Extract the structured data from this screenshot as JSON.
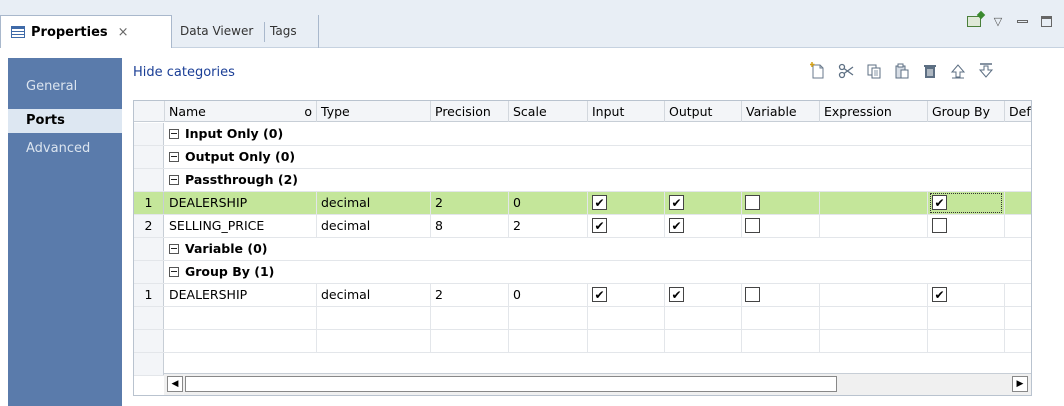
{
  "tabs": [
    {
      "label": "Properties",
      "active": true
    },
    {
      "label": "Data Viewer",
      "active": false
    },
    {
      "label": "Tags",
      "active": false
    }
  ],
  "tab_close": "×",
  "sidebar": {
    "items": [
      {
        "label": "General",
        "active": false
      },
      {
        "label": "Ports",
        "active": true
      },
      {
        "label": "Advanced",
        "active": false
      }
    ]
  },
  "hide_categories": "Hide categories",
  "toolbar_icons": [
    "new-port-icon",
    "cut-icon",
    "copy-icon",
    "paste-icon",
    "delete-icon",
    "move-up-icon",
    "move-down-icon"
  ],
  "grid": {
    "headers": [
      "Name",
      "Type",
      "Precision",
      "Scale",
      "Input",
      "Output",
      "Variable",
      "Expression",
      "Group By",
      "Defaul"
    ],
    "sort_marker": "o",
    "categories": {
      "input_only": "Input Only (0)",
      "output_only": "Output Only (0)",
      "passthrough": "Passthrough (2)",
      "variable": "Variable (0)",
      "group_by": "Group By (1)"
    },
    "passthrough_rows": [
      {
        "num": "1",
        "name": "DEALERSHIP",
        "type": "decimal",
        "precision": "2",
        "scale": "0",
        "input": true,
        "output": true,
        "variable": false,
        "group_by": true,
        "highlighted": true
      },
      {
        "num": "2",
        "name": "SELLING_PRICE",
        "type": "decimal",
        "precision": "8",
        "scale": "2",
        "input": true,
        "output": true,
        "variable": false,
        "group_by": false,
        "highlighted": false
      }
    ],
    "group_by_rows": [
      {
        "num": "1",
        "name": "DEALERSHIP",
        "type": "decimal",
        "precision": "2",
        "scale": "0",
        "input": true,
        "output": true,
        "variable": false,
        "group_by": true
      }
    ]
  },
  "colors": {
    "sidebar_bg": "#5a7bab",
    "row_highlight": "#c4e69a",
    "link": "#1a3e96"
  }
}
